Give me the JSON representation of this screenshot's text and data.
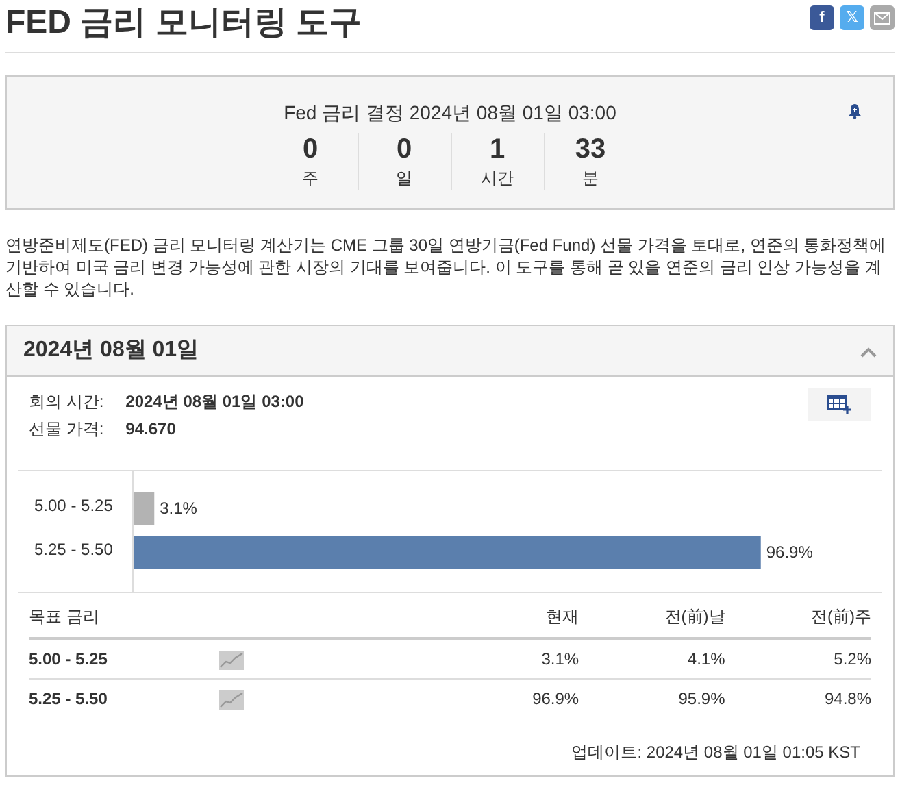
{
  "title": "FED 금리 모니터링 도구",
  "share_buttons": [
    {
      "kind": "facebook",
      "label": "f",
      "color": "#3b5998"
    },
    {
      "kind": "x",
      "label": "𝕏",
      "color": "#55acee"
    },
    {
      "kind": "email",
      "color": "#aaaaaa"
    }
  ],
  "countdown": {
    "heading": "Fed 금리 결정 2024년 08월 01일 03:00",
    "units": [
      {
        "value": "0",
        "unit": "주"
      },
      {
        "value": "0",
        "unit": "일"
      },
      {
        "value": "1",
        "unit": "시간"
      },
      {
        "value": "33",
        "unit": "분"
      }
    ]
  },
  "description": "연방준비제도(FED) 금리 모니터링 계산기는 CME 그룹 30일 연방기금(Fed Fund) 선물 가격을 토대로, 연준의 통화정책에 기반하여 미국 금리 변경 가능성에 관한 시장의 기대를 보여줍니다. 이 도구를 통해 곧 있을 연준의 금리 인상 가능성을 계산할 수 있습니다.",
  "meeting": {
    "title": "2024년 08월 01일",
    "expanded": true,
    "info": [
      {
        "label": "회의 시간:",
        "value": "2024년 08월 01일 03:00"
      },
      {
        "label": "선물 가격:",
        "value": "94.670"
      }
    ],
    "chart_data": {
      "type": "bar",
      "orientation": "horizontal",
      "categories": [
        "5.00 - 5.25",
        "5.25 - 5.50"
      ],
      "values": [
        3.1,
        96.9
      ],
      "value_labels": [
        "3.1%",
        "96.9%"
      ],
      "colors": [
        "#b3b3b3",
        "#5b7fad"
      ]
    },
    "table": {
      "columns": [
        "목표 금리",
        "현재",
        "전(前)날",
        "전(前)주"
      ],
      "rows": [
        {
          "cells": [
            "5.00 - 5.25",
            "3.1%",
            "4.1%",
            "5.2%"
          ]
        },
        {
          "cells": [
            "5.25 - 5.50",
            "96.9%",
            "95.9%",
            "94.8%"
          ]
        }
      ]
    },
    "updated": "업데이트: 2024년 08월 01일 01:05 KST"
  }
}
